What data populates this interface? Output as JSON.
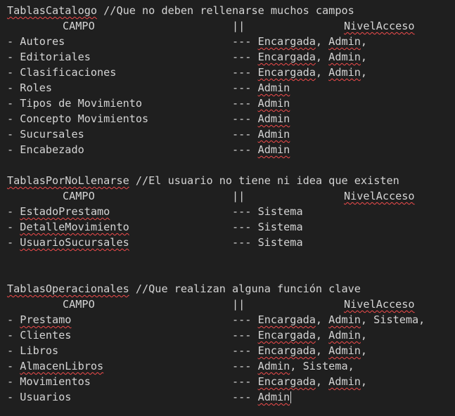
{
  "sections": [
    {
      "header_name": "TablasCatalogo",
      "header_comment": " //Que no deben rellenarse muchos campos",
      "col_campo": "CAMPO",
      "col_sep": "||",
      "col_nivel": "NivelAcceso",
      "rows": [
        {
          "dash": "- ",
          "name": "Autores",
          "sep": "--- ",
          "access": [
            {
              "t": "Encargada",
              "sq": true
            },
            {
              "t": ", "
            },
            {
              "t": "Admin",
              "sq": true
            },
            {
              "t": ","
            }
          ]
        },
        {
          "dash": "- ",
          "name": "Editoriales",
          "sep": "--- ",
          "access": [
            {
              "t": "Encargada",
              "sq": true
            },
            {
              "t": ", "
            },
            {
              "t": "Admin",
              "sq": true
            },
            {
              "t": ","
            }
          ]
        },
        {
          "dash": "- ",
          "name": "Clasificaciones",
          "sep": "--- ",
          "access": [
            {
              "t": "Encargada",
              "sq": true
            },
            {
              "t": ", "
            },
            {
              "t": "Admin",
              "sq": true
            },
            {
              "t": ","
            }
          ]
        },
        {
          "dash": "- ",
          "name": "Roles",
          "sep": "--- ",
          "access": [
            {
              "t": "Admin",
              "sq": true
            }
          ]
        },
        {
          "dash": "- ",
          "name": "Tipos de Movimiento",
          "sep": "--- ",
          "access": [
            {
              "t": "Admin",
              "sq": true
            }
          ]
        },
        {
          "dash": "- ",
          "name": "Concepto Movimientos",
          "sep": "--- ",
          "access": [
            {
              "t": "Admin",
              "sq": true
            }
          ]
        },
        {
          "dash": "- ",
          "name": "Sucursales",
          "sep": "--- ",
          "access": [
            {
              "t": "Admin",
              "sq": true
            }
          ]
        },
        {
          "dash": "- ",
          "name": "Encabezado",
          "sep": "--- ",
          "access": [
            {
              "t": "Admin",
              "sq": true
            }
          ]
        }
      ]
    },
    {
      "header_name": "TablasPorNoLlenarse",
      "header_comment": " //El usuario no tiene ni idea que existen",
      "col_campo": "CAMPO",
      "col_sep": "||",
      "col_nivel": "NivelAcceso",
      "rows": [
        {
          "dash": "- ",
          "name": "EstadoPrestamo",
          "name_sq": true,
          "sep": "--- ",
          "access": [
            {
              "t": "Sistema"
            }
          ]
        },
        {
          "dash": "- ",
          "name": "DetalleMovimiento",
          "name_sq": true,
          "sep": "--- ",
          "access": [
            {
              "t": "Sistema"
            }
          ]
        },
        {
          "dash": "- ",
          "name": "UsuarioSucursales",
          "name_sq": true,
          "sep": "--- ",
          "access": [
            {
              "t": "Sistema"
            }
          ]
        }
      ]
    },
    {
      "header_name": "TablasOperacionales",
      "header_comment": " //Que realizan alguna función clave",
      "col_campo": "CAMPO",
      "col_sep": "||",
      "col_nivel": "NivelAcceso",
      "rows": [
        {
          "dash": "- ",
          "name": "Prestamo",
          "name_sq": true,
          "sep": "--- ",
          "access": [
            {
              "t": "Encargada",
              "sq": true
            },
            {
              "t": ", "
            },
            {
              "t": "Admin",
              "sq": true
            },
            {
              "t": ", Sistema,"
            }
          ]
        },
        {
          "dash": "- ",
          "name": "Clientes",
          "sep": "--- ",
          "access": [
            {
              "t": "Encargada",
              "sq": true
            },
            {
              "t": ", "
            },
            {
              "t": "Admin",
              "sq": true
            },
            {
              "t": ","
            }
          ]
        },
        {
          "dash": "- ",
          "name": "Libros",
          "sep": "--- ",
          "access": [
            {
              "t": "Encargada",
              "sq": true
            },
            {
              "t": ", "
            },
            {
              "t": "Admin",
              "sq": true
            },
            {
              "t": ","
            }
          ]
        },
        {
          "dash": "- ",
          "name": "AlmacenLibros",
          "name_sq": true,
          "sep": "--- ",
          "access": [
            {
              "t": "Admin",
              "sq": true
            },
            {
              "t": ", Sistema,"
            }
          ]
        },
        {
          "dash": "- ",
          "name": "Movimientos",
          "sep": "--- ",
          "access": [
            {
              "t": "Encargada",
              "sq": true
            },
            {
              "t": ", "
            },
            {
              "t": "Admin",
              "sq": true
            },
            {
              "t": ","
            }
          ]
        },
        {
          "dash": "- ",
          "name": "Usuarios",
          "sep": "--- ",
          "access": [
            {
              "t": "Admin",
              "sq": true
            }
          ],
          "cursor": true
        }
      ]
    }
  ],
  "colors": {
    "background": "#1f1f1f",
    "text": "#d4d4d4",
    "squiggle": "#f14c4c"
  }
}
